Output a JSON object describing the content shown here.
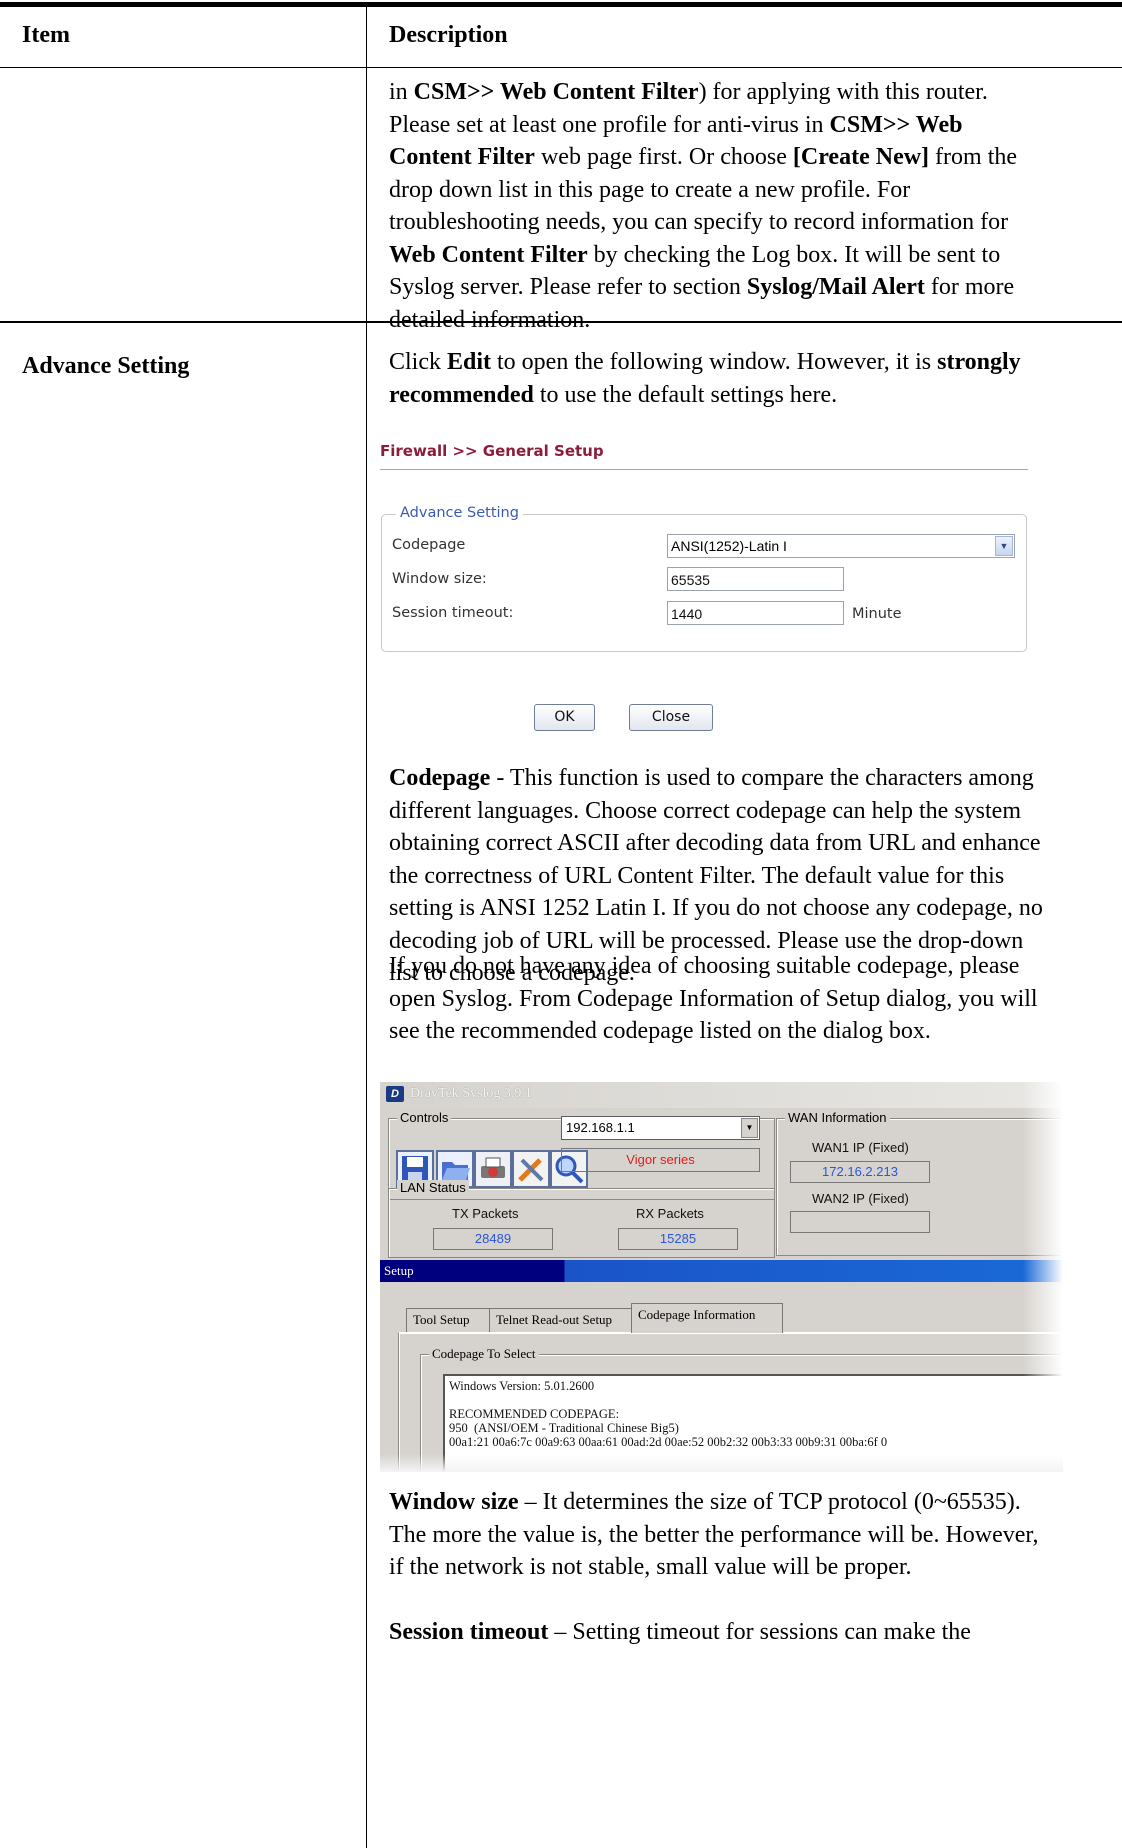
{
  "table": {
    "header_item": "Item",
    "header_description": "Description"
  },
  "row1": {
    "p1": [
      {
        "t": "in ",
        "b": false
      },
      {
        "t": "CSM>> Web Content Filter",
        "b": true
      },
      {
        "t": ") for applying with this router. Please set at least one profile for anti-virus in ",
        "b": false
      },
      {
        "t": "CSM>> Web Content Filter",
        "b": true
      },
      {
        "t": " web page first. Or choose ",
        "b": false
      },
      {
        "t": "[Create New]",
        "b": true
      },
      {
        "t": " from the drop down list in this page to create a new profile. For troubleshooting needs, you can specify to record information for ",
        "b": false
      },
      {
        "t": "Web Content Filter",
        "b": true
      },
      {
        "t": " by checking the Log box. It will be sent to Syslog server. Please refer to section ",
        "b": false
      },
      {
        "t": "Syslog/Mail Alert",
        "b": true
      },
      {
        "t": " for more detailed information.",
        "b": false
      }
    ]
  },
  "row2": {
    "item": "Advance Setting",
    "intro": [
      {
        "t": "Click ",
        "b": false
      },
      {
        "t": "Edit",
        "b": true
      },
      {
        "t": " to open the following window. However, it is ",
        "b": false
      },
      {
        "t": "strongly recommended",
        "b": true
      },
      {
        "t": " to use the default settings here.",
        "b": false
      }
    ],
    "codepage_desc": [
      {
        "t": "Codepage",
        "b": true
      },
      {
        "t": " - This function is used to compare the characters among different languages. Choose correct codepage can help the system obtaining correct ASCII after decoding data from URL and enhance the correctness of URL Content Filter. The default value for this setting is ANSI 1252 Latin I. If you do not choose any codepage, no decoding job of URL will be processed. Please use the drop-down list to choose a codepage.",
        "b": false
      }
    ],
    "codepage_hint": [
      {
        "t": "If you do not have any idea of choosing suitable codepage, please open Syslog. From Codepage Information of Setup dialog, you will see the recommended codepage listed on the dialog box.",
        "b": false
      }
    ],
    "window_desc": [
      {
        "t": "Window size",
        "b": true
      },
      {
        "t": " – It determines the size of TCP protocol (0~65535). The more the value is, the better the performance will be. However, if the network is not stable, small value will be proper.",
        "b": false
      }
    ],
    "session_desc": [
      {
        "t": "Session timeout",
        "b": true
      },
      {
        "t": " – Setting timeout for sessions can make the",
        "b": false
      }
    ]
  },
  "firewall": {
    "title": "Firewall >> General Setup",
    "legend": "Advance Setting",
    "codepage_label": "Codepage",
    "codepage_value": "ANSI(1252)-Latin I",
    "window_label": "Window size:",
    "window_value": "65535",
    "session_label": "Session timeout:",
    "session_value": "1440",
    "session_unit": "Minute",
    "ok_label": "OK",
    "close_label": "Close"
  },
  "syslog": {
    "title": "DrayTek Syslog 3.9.1",
    "controls_label": "Controls",
    "ip_value": "192.168.1.1",
    "series": "Vigor series",
    "wan_info_label": "WAN Information",
    "wan1_label": "WAN1 IP (Fixed)",
    "wan1_value": "172.16.2.213",
    "wan2_label": "WAN2 IP (Fixed)",
    "lan_status_label": "LAN Status",
    "tx_label": "TX Packets",
    "tx_value": "28489",
    "rx_label": "RX Packets",
    "rx_value": "15285",
    "setup_label": "Setup",
    "tabs": [
      "Tool Setup",
      "Telnet Read-out Setup",
      "Codepage Information"
    ],
    "codepage_group": "Codepage To Select",
    "memo_text": "Windows Version: 5.01.2600\n\nRECOMMENDED CODEPAGE:\n950  (ANSI/OEM - Traditional Chinese Big5)\n00a1:21 00a6:7c 00a9:63 00aa:61 00ad:2d 00ae:52 00b2:32 00b3:33 00b9:31 00ba:6f 0"
  }
}
